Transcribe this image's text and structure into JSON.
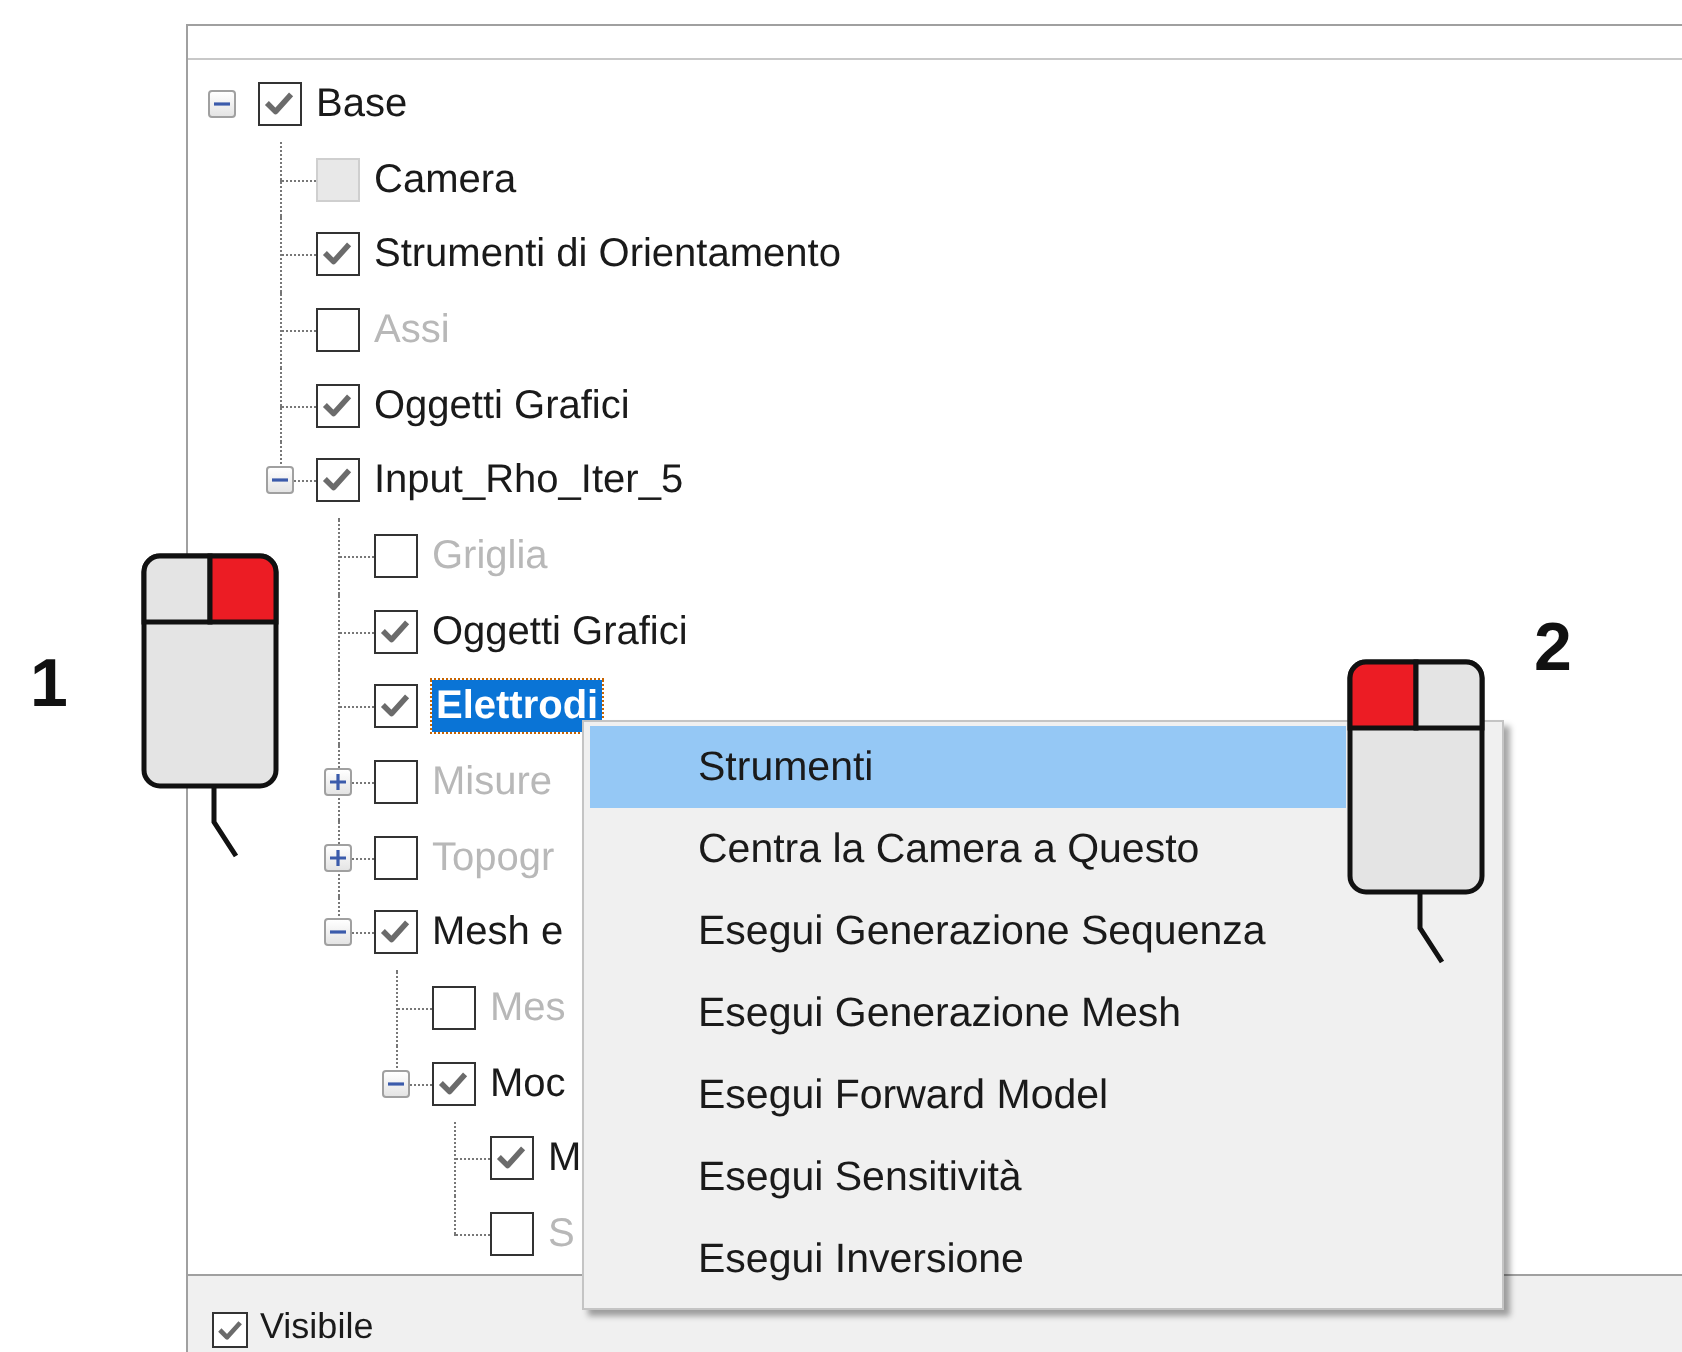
{
  "panel": {
    "tree": [
      {
        "label": "Base",
        "checked": true,
        "enabled": true,
        "dimmed": false,
        "selected": false,
        "expanded": true,
        "children": [
          {
            "label": "Camera",
            "checked": false,
            "enabled": false,
            "dimmed": false,
            "selected": false
          },
          {
            "label": "Strumenti di Orientamento",
            "checked": true,
            "enabled": true,
            "dimmed": false,
            "selected": false
          },
          {
            "label": "Assi",
            "checked": false,
            "enabled": true,
            "dimmed": true,
            "selected": false
          },
          {
            "label": "Oggetti Grafici",
            "checked": true,
            "enabled": true,
            "dimmed": false,
            "selected": false
          },
          {
            "label": "Input_Rho_Iter_5",
            "checked": true,
            "enabled": true,
            "dimmed": false,
            "selected": false,
            "expanded": true,
            "children": [
              {
                "label": "Griglia",
                "checked": false,
                "enabled": true,
                "dimmed": true,
                "selected": false
              },
              {
                "label": "Oggetti Grafici",
                "checked": true,
                "enabled": true,
                "dimmed": false,
                "selected": false
              },
              {
                "label": "Elettrodi",
                "checked": true,
                "enabled": true,
                "dimmed": false,
                "selected": true
              },
              {
                "label": "Misure",
                "checked": false,
                "enabled": true,
                "dimmed": true,
                "selected": false,
                "expanded": false
              },
              {
                "label": "Topogr",
                "checked": false,
                "enabled": true,
                "dimmed": true,
                "selected": false,
                "expanded": false
              },
              {
                "label": "Mesh e",
                "checked": true,
                "enabled": true,
                "dimmed": false,
                "selected": false,
                "expanded": true,
                "children": [
                  {
                    "label": "Mes",
                    "checked": false,
                    "enabled": true,
                    "dimmed": true,
                    "selected": false
                  },
                  {
                    "label": "Moc",
                    "checked": true,
                    "enabled": true,
                    "dimmed": false,
                    "selected": false,
                    "expanded": true,
                    "children": [
                      {
                        "label": "M",
                        "checked": true,
                        "enabled": true,
                        "dimmed": false,
                        "selected": false
                      },
                      {
                        "label": "S",
                        "checked": false,
                        "enabled": true,
                        "dimmed": true,
                        "selected": false
                      }
                    ]
                  }
                ]
              }
            ]
          }
        ]
      }
    ],
    "visible_option": {
      "label": "Visibile",
      "checked": true
    }
  },
  "context_menu": {
    "items": [
      {
        "label": "Strumenti",
        "selected": true
      },
      {
        "label": "Centra la Camera a Questo",
        "selected": false
      },
      {
        "label": "Esegui Generazione Sequenza",
        "selected": false
      },
      {
        "label": "Esegui Generazione Mesh",
        "selected": false
      },
      {
        "label": "Esegui Forward Model",
        "selected": false
      },
      {
        "label": "Esegui Sensitività",
        "selected": false
      },
      {
        "label": "Esegui Inversione",
        "selected": false
      }
    ]
  },
  "callouts": [
    {
      "number": "1",
      "left_pressed": false,
      "right_pressed": true
    },
    {
      "number": "2",
      "left_pressed": true,
      "right_pressed": false
    }
  ]
}
